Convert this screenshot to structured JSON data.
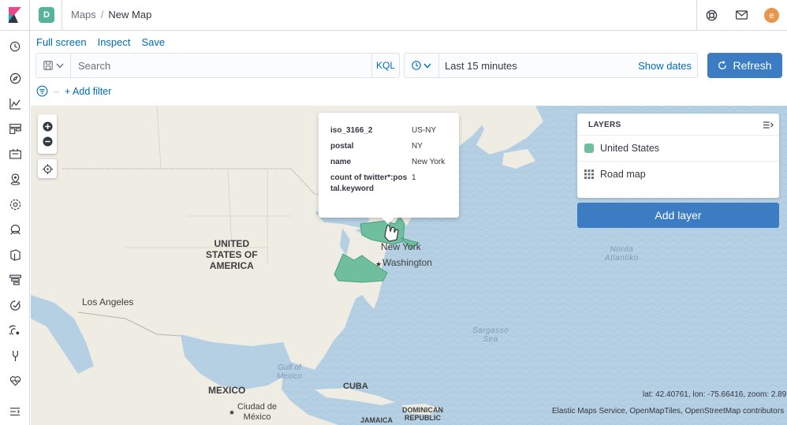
{
  "header": {
    "space_initial": "D",
    "breadcrumbs": [
      "Maps",
      "New Map"
    ],
    "avatar_initial": "e"
  },
  "menu": {
    "items": [
      "Full screen",
      "Inspect",
      "Save"
    ]
  },
  "search": {
    "placeholder": "Search",
    "language": "KQL"
  },
  "datepicker": {
    "range": "Last 15 minutes",
    "show_dates": "Show dates"
  },
  "refresh_label": "Refresh",
  "filter": {
    "add_label": "+ Add filter",
    "separator": "–"
  },
  "tooltip": {
    "rows": [
      {
        "key": "iso_3166_2",
        "value": "US-NY"
      },
      {
        "key": "postal",
        "value": "NY"
      },
      {
        "key": "name",
        "value": "New York"
      },
      {
        "key": "count of twitter*:postal.keyword",
        "value": "1"
      }
    ]
  },
  "layers_panel": {
    "title": "LAYERS",
    "items": [
      {
        "label": "United States",
        "icon": "swatch"
      },
      {
        "label": "Road map",
        "icon": "grid-icon"
      }
    ],
    "add_layer": "Add layer"
  },
  "map": {
    "labels": {
      "usa": [
        "UNITED",
        "STATES OF",
        "AMERICA"
      ],
      "los_angeles": "Los Angeles",
      "new_york": "New York",
      "washington": "Washington",
      "north_atlantic": [
        "Norda",
        "Atlantiko"
      ],
      "sargasso": [
        "Sargasso",
        "Sea"
      ],
      "gulf": [
        "Gulf of",
        "Mexico"
      ],
      "mexico": "MEXICO",
      "cuba": "CUBA",
      "ciudad": [
        "Ciudad de",
        "México"
      ],
      "dominican": [
        "DOMINICAN",
        "REPUBLIC"
      ],
      "jamaica": "JAMAICA"
    },
    "coords": "lat: 42.40761, lon: -75.66416, zoom: 2.89",
    "attribution": "Elastic Maps Service, OpenMapTiles, OpenStreetMap contributors",
    "colors": {
      "ocean": "#b5d0e3",
      "land": "#efece4",
      "state_fill": "#6fbf9e",
      "accent": "#3c7cc3"
    }
  }
}
